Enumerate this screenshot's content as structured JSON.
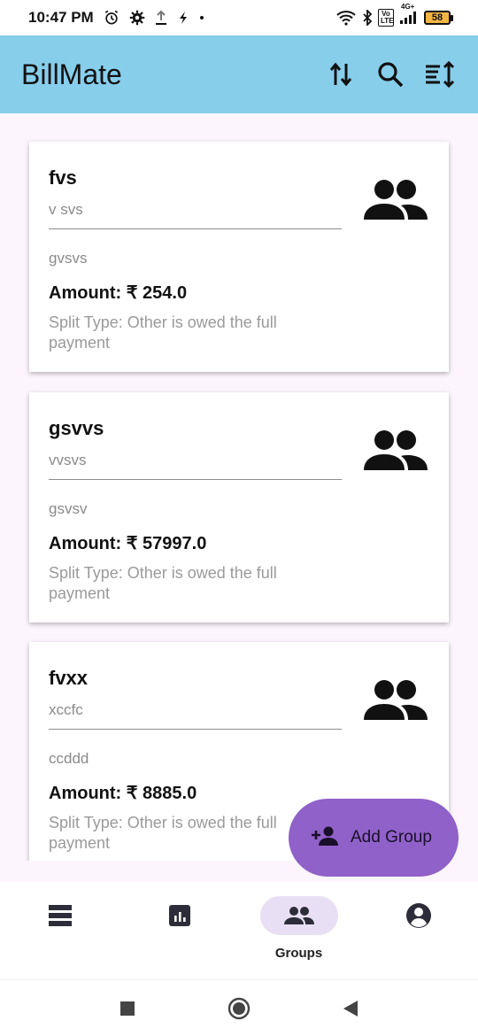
{
  "status_bar": {
    "time": "10:47 PM",
    "left_icons": [
      "alarm-icon",
      "settings-gear-icon",
      "upload-icon",
      "flash-icon",
      "dot-icon"
    ],
    "right_icons": [
      "wifi-icon",
      "bluetooth-icon",
      "volte-icon",
      "signal-4g-icon"
    ],
    "network_label": "4G+",
    "volte_label": "Vo LTE",
    "battery_level": "58"
  },
  "app_bar": {
    "title": "BillMate",
    "actions": [
      "swap-vert-icon",
      "search-icon",
      "sort-icon"
    ]
  },
  "cards": [
    {
      "title": "fvs",
      "description": "v svs",
      "note": "gvsvs",
      "amount": "Amount: ₹ 254.0",
      "split": "Split Type: Other is owed the full payment",
      "icon": "group-icon"
    },
    {
      "title": "gsvvs",
      "description": "vvsvs",
      "note": "gsvsv",
      "amount": "Amount: ₹ 57997.0",
      "split": "Split Type: Other is owed the full payment",
      "icon": "group-icon"
    },
    {
      "title": "fvxx",
      "description": "xccfc",
      "note": "ccddd",
      "amount": "Amount: ₹ 8885.0",
      "split": "Split Type: Other is owed the full payment",
      "icon": "group-icon"
    }
  ],
  "fab": {
    "label": "Add Group",
    "icon": "person-add-icon",
    "color": "#9061c8"
  },
  "bottom_nav": {
    "items": [
      {
        "icon": "view-list-icon",
        "label": ""
      },
      {
        "icon": "analytics-icon",
        "label": ""
      },
      {
        "icon": "groups-icon",
        "label": "Groups",
        "active": true
      },
      {
        "icon": "account-circle-icon",
        "label": ""
      }
    ]
  },
  "colors": {
    "app_bar": "#87ceeb",
    "background": "#fdf5fd",
    "active_nav": "#e9dff5"
  }
}
